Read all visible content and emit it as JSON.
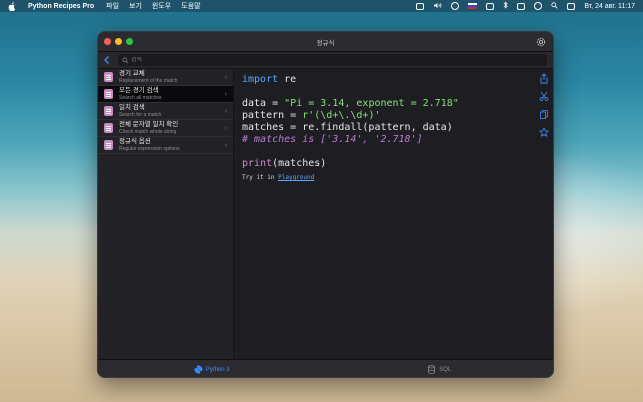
{
  "menubar": {
    "app_name": "Python Recipes Pro",
    "menus": [
      "파일",
      "보기",
      "윈도우",
      "도움말"
    ],
    "datetime": "Вт, 24 авг.  11:17"
  },
  "window": {
    "title": "정규식",
    "search": {
      "placeholder": "검색",
      "value": ""
    }
  },
  "sidebar": {
    "items": [
      {
        "title": "경기 교체",
        "subtitle": "Replacement of the match"
      },
      {
        "title": "모든 경기 검색",
        "subtitle": "Search all matches"
      },
      {
        "title": "일치 검색",
        "subtitle": "Search for a match"
      },
      {
        "title": "전체 문자열 일치 확인",
        "subtitle": "Check match whole string"
      },
      {
        "title": "정규식 옵션",
        "subtitle": "Regular expression options"
      }
    ]
  },
  "code": {
    "line1_kw": "import",
    "line1_rest": " re",
    "line2_a": "data = ",
    "line2_str": "\"Pi = 3.14, exponent = 2.718\"",
    "line3_a": "pattern = ",
    "line3_str": "r'(\\d+\\.\\d+)'",
    "line4": "matches = re.findall(pattern, data)",
    "line5_comment": "# matches is ['3.14', '2.718']",
    "line6_fn": "print",
    "line6_rest": "(matches)",
    "try_text": "Try it in ",
    "try_link": "Playground"
  },
  "tabs": [
    {
      "label": "Python 3",
      "active": true
    },
    {
      "label": "SQL",
      "active": false
    }
  ],
  "colors": {
    "accent": "#3d8bff",
    "keyword": "#5aa7ff",
    "string": "#86e07a",
    "comment": "#b87bd6"
  }
}
